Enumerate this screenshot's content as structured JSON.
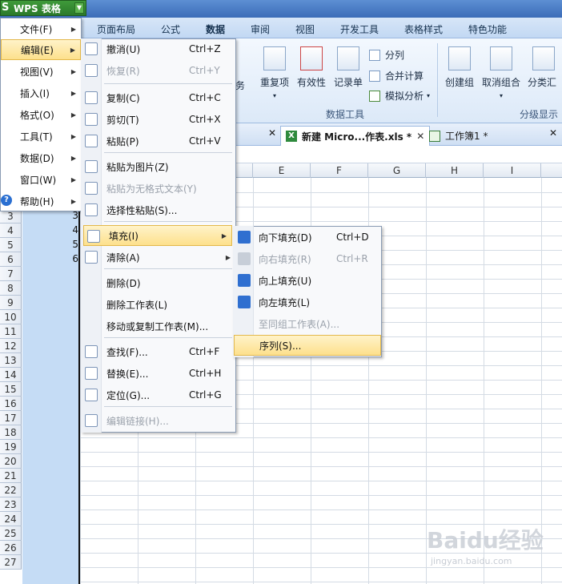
{
  "app": {
    "title": "WPS 表格",
    "logo": "S"
  },
  "ribbon_tabs": [
    "页面布局",
    "公式",
    "数据",
    "审阅",
    "视图",
    "开发工具",
    "表格样式",
    "特色功能"
  ],
  "ribbon": {
    "dup_label": "重复项",
    "valid_label": "有效性",
    "record_label": "记录单",
    "split_label": "分列",
    "merge_calc_label": "合并计算",
    "simulate_label": "模拟分析",
    "create_group_label": "创建组",
    "ungroup_label": "取消组合",
    "subtotal_label": "分类汇",
    "tools_group_label": "数据工具",
    "outline_group_label": "分级显示",
    "partial_label": "务"
  },
  "doc_tabs": [
    {
      "label": "新建 Micro...作表.xls *"
    },
    {
      "label": "工作簿1 *"
    }
  ],
  "columns": [
    "E",
    "F",
    "G",
    "H",
    "I"
  ],
  "rows": [
    "3",
    "4",
    "5",
    "6",
    "7",
    "8",
    "9",
    "10",
    "11",
    "12",
    "13",
    "14",
    "15",
    "16",
    "17",
    "18",
    "19",
    "20",
    "21",
    "22",
    "23",
    "24",
    "25",
    "26",
    "27"
  ],
  "cells_b": [
    "3",
    "4",
    "5",
    "6"
  ],
  "main_menu": [
    {
      "label": "文件(F)"
    },
    {
      "label": "编辑(E)"
    },
    {
      "label": "视图(V)"
    },
    {
      "label": "插入(I)"
    },
    {
      "label": "格式(O)"
    },
    {
      "label": "工具(T)"
    },
    {
      "label": "数据(D)"
    },
    {
      "label": "窗口(W)"
    },
    {
      "label": "帮助(H)"
    }
  ],
  "edit_menu": [
    {
      "label": "撤消(U)",
      "shortcut": "Ctrl+Z"
    },
    {
      "label": "恢复(R)",
      "shortcut": "Ctrl+Y"
    },
    {
      "label": "复制(C)",
      "shortcut": "Ctrl+C"
    },
    {
      "label": "剪切(T)",
      "shortcut": "Ctrl+X"
    },
    {
      "label": "粘贴(P)",
      "shortcut": "Ctrl+V"
    },
    {
      "label": "粘贴为图片(Z)",
      "shortcut": ""
    },
    {
      "label": "粘贴为无格式文本(Y)",
      "shortcut": ""
    },
    {
      "label": "选择性粘贴(S)...",
      "shortcut": ""
    },
    {
      "label": "填充(I)",
      "shortcut": ""
    },
    {
      "label": "清除(A)",
      "shortcut": ""
    },
    {
      "label": "删除(D)",
      "shortcut": ""
    },
    {
      "label": "删除工作表(L)",
      "shortcut": ""
    },
    {
      "label": "移动或复制工作表(M)...",
      "shortcut": ""
    },
    {
      "label": "查找(F)...",
      "shortcut": "Ctrl+F"
    },
    {
      "label": "替换(E)...",
      "shortcut": "Ctrl+H"
    },
    {
      "label": "定位(G)...",
      "shortcut": "Ctrl+G"
    },
    {
      "label": "编辑链接(H)...",
      "shortcut": ""
    }
  ],
  "fill_menu": [
    {
      "label": "向下填充(D)",
      "shortcut": "Ctrl+D"
    },
    {
      "label": "向右填充(R)",
      "shortcut": "Ctrl+R"
    },
    {
      "label": "向上填充(U)",
      "shortcut": ""
    },
    {
      "label": "向左填充(L)",
      "shortcut": ""
    },
    {
      "label": "至同组工作表(A)...",
      "shortcut": ""
    },
    {
      "label": "序列(S)...",
      "shortcut": ""
    }
  ],
  "watermark": {
    "main": "Baidu经验",
    "sub": "jingyan.baidu.com"
  },
  "colors": {
    "accent": "#3b6cb8",
    "highlight": "#fde08c",
    "selection": "#c5dcf5"
  }
}
